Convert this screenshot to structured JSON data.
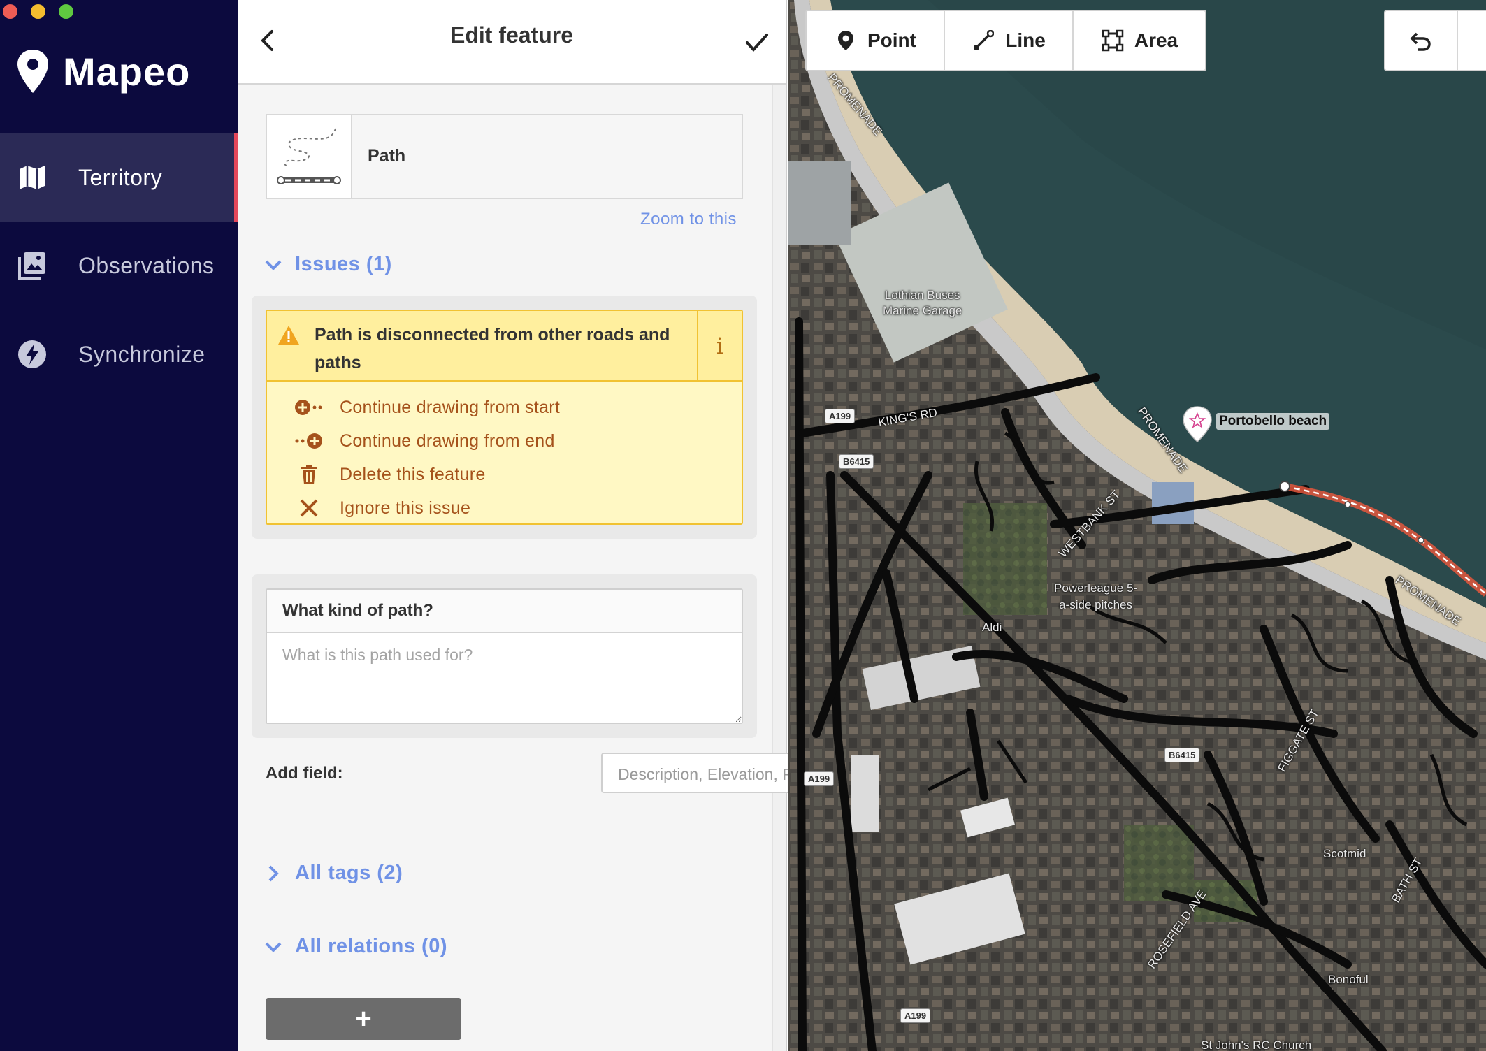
{
  "window": {
    "controls": [
      "close",
      "minimize",
      "maximize"
    ]
  },
  "app": {
    "name": "Mapeo"
  },
  "sidebar": {
    "items": [
      {
        "label": "Territory",
        "icon": "map-icon",
        "active": true
      },
      {
        "label": "Observations",
        "icon": "photos-icon",
        "active": false
      },
      {
        "label": "Synchronize",
        "icon": "lightning-icon",
        "active": false
      }
    ]
  },
  "editor": {
    "title": "Edit feature",
    "preset": {
      "name": "Path",
      "icon": "path-preset-icon"
    },
    "zoom_link": "Zoom to this",
    "issues": {
      "label": "Issues (1)",
      "expanded": true,
      "message": "Path is disconnected from other roads and paths",
      "info": "i",
      "fixes": [
        {
          "label": "Continue drawing from start",
          "icon": "continue-start-icon"
        },
        {
          "label": "Continue drawing from end",
          "icon": "continue-end-icon"
        },
        {
          "label": "Delete this feature",
          "icon": "trash-icon"
        },
        {
          "label": "Ignore this issue",
          "icon": "close-icon"
        }
      ]
    },
    "kind_field": {
      "label": "What kind of path?",
      "value": "",
      "placeholder": "What is this path used for?"
    },
    "add_field": {
      "label": "Add field:",
      "placeholder": "Description, Elevation, Fix Me..."
    },
    "all_tags": {
      "label": "All tags (2)",
      "expanded": false
    },
    "all_relations": {
      "label": "All relations (0)",
      "expanded": true
    },
    "add_relation_label": "+"
  },
  "toolbar": {
    "point_label": "Point",
    "line_label": "Line",
    "area_label": "Area"
  },
  "map": {
    "labels": {
      "promenade_1": "PROMENADE",
      "promenade_2": "PROMENADE",
      "promenade_3": "PROMENADE",
      "kings_rd": "KING'S RD",
      "westbank_st": "WESTBANK ST",
      "figgate_st": "FIGGATE ST",
      "rosefield_ave": "ROSEFIELD AVE",
      "bath_st": "BATH ST",
      "lothian_buses": "Lothian Buses\nMarine Garage",
      "powerleague": "Powerleague 5-\na-side pitches",
      "aldi": "Aldi",
      "scotmid": "Scotmid",
      "bonoful": "Bonoful",
      "st_johns": "St John's RC Church"
    },
    "shields": [
      "A199",
      "B6415",
      "A199",
      "B6415",
      "A199"
    ],
    "poi": {
      "label": "Portobello beach",
      "icon": "star-marker-icon"
    },
    "colors": {
      "sea": "#2b4a4c",
      "beach": "#d9cdb3",
      "promenade": "#c9c9c9",
      "roads": "#0b0b0b",
      "selected_path": "#e4573d"
    }
  },
  "colors": {
    "sidebar_bg": "#0c0a3e",
    "accent": "#7092e6",
    "active_marker": "#e4475a",
    "warning_bg": "#fff8c4",
    "warning_border": "#f1c232",
    "fix_text": "#a5521b"
  }
}
